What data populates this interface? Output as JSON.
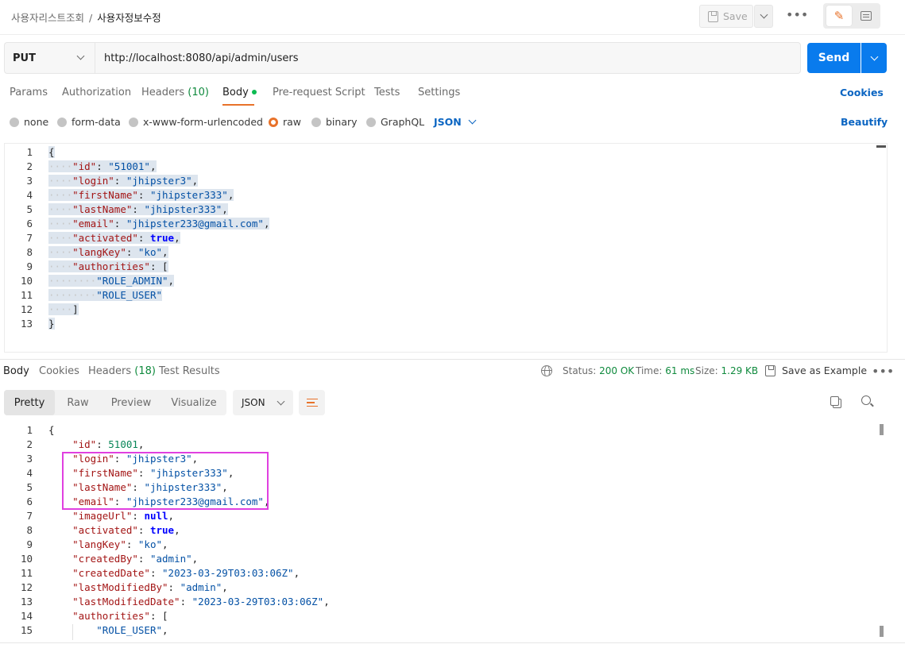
{
  "breadcrumb": {
    "parent": "사용자리스트조회",
    "separator": "/",
    "current": "사용자정보수정"
  },
  "header": {
    "save_label": "Save",
    "more_icon": "more-horizontal-icon"
  },
  "request": {
    "method": "PUT",
    "url": "http://localhost:8080/api/admin/users",
    "send_label": "Send"
  },
  "request_tabs": {
    "params": "Params",
    "authorization": "Authorization",
    "headers": "Headers",
    "headers_count": "(10)",
    "body": "Body",
    "prerequest": "Pre-request Script",
    "tests": "Tests",
    "settings": "Settings",
    "cookies": "Cookies"
  },
  "body_types": {
    "none": "none",
    "form_data": "form-data",
    "urlencoded": "x-www-form-urlencoded",
    "raw": "raw",
    "binary": "binary",
    "graphql": "GraphQL",
    "format": "JSON",
    "beautify": "Beautify"
  },
  "request_body": [
    {
      "ln": "1",
      "indent": 0,
      "parts": [
        {
          "t": "{",
          "c": "p"
        }
      ]
    },
    {
      "ln": "2",
      "indent": 1,
      "parts": [
        {
          "t": "\"id\"",
          "c": "k"
        },
        {
          "t": ": ",
          "c": "p"
        },
        {
          "t": "\"51001\"",
          "c": "s"
        },
        {
          "t": ",",
          "c": "p"
        }
      ]
    },
    {
      "ln": "3",
      "indent": 1,
      "parts": [
        {
          "t": "\"login\"",
          "c": "k"
        },
        {
          "t": ": ",
          "c": "p"
        },
        {
          "t": "\"jhipster3\"",
          "c": "s"
        },
        {
          "t": ",",
          "c": "p"
        }
      ]
    },
    {
      "ln": "4",
      "indent": 1,
      "parts": [
        {
          "t": "\"firstName\"",
          "c": "k"
        },
        {
          "t": ": ",
          "c": "p"
        },
        {
          "t": "\"jhipster333\"",
          "c": "s"
        },
        {
          "t": ",",
          "c": "p"
        }
      ]
    },
    {
      "ln": "5",
      "indent": 1,
      "parts": [
        {
          "t": "\"lastName\"",
          "c": "k"
        },
        {
          "t": ": ",
          "c": "p"
        },
        {
          "t": "\"jhipster333\"",
          "c": "s"
        },
        {
          "t": ",",
          "c": "p"
        }
      ]
    },
    {
      "ln": "6",
      "indent": 1,
      "parts": [
        {
          "t": "\"email\"",
          "c": "k"
        },
        {
          "t": ": ",
          "c": "p"
        },
        {
          "t": "\"jhipster233@gmail.com\"",
          "c": "s"
        },
        {
          "t": ",",
          "c": "p"
        }
      ]
    },
    {
      "ln": "7",
      "indent": 1,
      "parts": [
        {
          "t": "\"activated\"",
          "c": "k"
        },
        {
          "t": ": ",
          "c": "p"
        },
        {
          "t": "true",
          "c": "b"
        },
        {
          "t": ",",
          "c": "p"
        }
      ]
    },
    {
      "ln": "8",
      "indent": 1,
      "parts": [
        {
          "t": "\"langKey\"",
          "c": "k"
        },
        {
          "t": ": ",
          "c": "p"
        },
        {
          "t": "\"ko\"",
          "c": "s"
        },
        {
          "t": ",",
          "c": "p"
        }
      ]
    },
    {
      "ln": "9",
      "indent": 1,
      "parts": [
        {
          "t": "\"authorities\"",
          "c": "k"
        },
        {
          "t": ": [",
          "c": "p"
        }
      ]
    },
    {
      "ln": "10",
      "indent": 2,
      "parts": [
        {
          "t": "\"ROLE_ADMIN\"",
          "c": "s"
        },
        {
          "t": ",",
          "c": "p"
        }
      ]
    },
    {
      "ln": "11",
      "indent": 2,
      "parts": [
        {
          "t": "\"ROLE_USER\"",
          "c": "s"
        }
      ]
    },
    {
      "ln": "12",
      "indent": 1,
      "parts": [
        {
          "t": "]",
          "c": "p"
        }
      ]
    },
    {
      "ln": "13",
      "indent": 0,
      "parts": [
        {
          "t": "}",
          "c": "p"
        }
      ]
    }
  ],
  "response_tabs": {
    "body": "Body",
    "cookies": "Cookies",
    "headers": "Headers",
    "headers_count": "(18)",
    "test_results": "Test Results"
  },
  "response_meta": {
    "status_label": "Status:",
    "status_value": "200 OK",
    "time_label": "Time:",
    "time_value": "61 ms",
    "size_label": "Size:",
    "size_value": "1.29 KB",
    "save_example": "Save as Example"
  },
  "response_views": {
    "pretty": "Pretty",
    "raw": "Raw",
    "preview": "Preview",
    "visualize": "Visualize",
    "format": "JSON"
  },
  "response_body": [
    {
      "ln": "1",
      "indent": 0,
      "parts": [
        {
          "t": "{",
          "c": "p"
        }
      ]
    },
    {
      "ln": "2",
      "indent": 1,
      "parts": [
        {
          "t": "\"id\"",
          "c": "k"
        },
        {
          "t": ": ",
          "c": "p"
        },
        {
          "t": "51001",
          "c": "n"
        },
        {
          "t": ",",
          "c": "p"
        }
      ]
    },
    {
      "ln": "3",
      "indent": 1,
      "parts": [
        {
          "t": "\"login\"",
          "c": "k"
        },
        {
          "t": ": ",
          "c": "p"
        },
        {
          "t": "\"jhipster3\"",
          "c": "s"
        },
        {
          "t": ",",
          "c": "p"
        }
      ]
    },
    {
      "ln": "4",
      "indent": 1,
      "parts": [
        {
          "t": "\"firstName\"",
          "c": "k"
        },
        {
          "t": ": ",
          "c": "p"
        },
        {
          "t": "\"jhipster333\"",
          "c": "s"
        },
        {
          "t": ",",
          "c": "p"
        }
      ]
    },
    {
      "ln": "5",
      "indent": 1,
      "parts": [
        {
          "t": "\"lastName\"",
          "c": "k"
        },
        {
          "t": ": ",
          "c": "p"
        },
        {
          "t": "\"jhipster333\"",
          "c": "s"
        },
        {
          "t": ",",
          "c": "p"
        }
      ]
    },
    {
      "ln": "6",
      "indent": 1,
      "parts": [
        {
          "t": "\"email\"",
          "c": "k"
        },
        {
          "t": ": ",
          "c": "p"
        },
        {
          "t": "\"jhipster233@gmail.com\"",
          "c": "s"
        },
        {
          "t": ",",
          "c": "p"
        }
      ]
    },
    {
      "ln": "7",
      "indent": 1,
      "parts": [
        {
          "t": "\"imageUrl\"",
          "c": "k"
        },
        {
          "t": ": ",
          "c": "p"
        },
        {
          "t": "null",
          "c": "b"
        },
        {
          "t": ",",
          "c": "p"
        }
      ]
    },
    {
      "ln": "8",
      "indent": 1,
      "parts": [
        {
          "t": "\"activated\"",
          "c": "k"
        },
        {
          "t": ": ",
          "c": "p"
        },
        {
          "t": "true",
          "c": "b"
        },
        {
          "t": ",",
          "c": "p"
        }
      ]
    },
    {
      "ln": "9",
      "indent": 1,
      "parts": [
        {
          "t": "\"langKey\"",
          "c": "k"
        },
        {
          "t": ": ",
          "c": "p"
        },
        {
          "t": "\"ko\"",
          "c": "s"
        },
        {
          "t": ",",
          "c": "p"
        }
      ]
    },
    {
      "ln": "10",
      "indent": 1,
      "parts": [
        {
          "t": "\"createdBy\"",
          "c": "k"
        },
        {
          "t": ": ",
          "c": "p"
        },
        {
          "t": "\"admin\"",
          "c": "s"
        },
        {
          "t": ",",
          "c": "p"
        }
      ]
    },
    {
      "ln": "11",
      "indent": 1,
      "parts": [
        {
          "t": "\"createdDate\"",
          "c": "k"
        },
        {
          "t": ": ",
          "c": "p"
        },
        {
          "t": "\"2023-03-29T03:03:06Z\"",
          "c": "s"
        },
        {
          "t": ",",
          "c": "p"
        }
      ]
    },
    {
      "ln": "12",
      "indent": 1,
      "parts": [
        {
          "t": "\"lastModifiedBy\"",
          "c": "k"
        },
        {
          "t": ": ",
          "c": "p"
        },
        {
          "t": "\"admin\"",
          "c": "s"
        },
        {
          "t": ",",
          "c": "p"
        }
      ]
    },
    {
      "ln": "13",
      "indent": 1,
      "parts": [
        {
          "t": "\"lastModifiedDate\"",
          "c": "k"
        },
        {
          "t": ": ",
          "c": "p"
        },
        {
          "t": "\"2023-03-29T03:03:06Z\"",
          "c": "s"
        },
        {
          "t": ",",
          "c": "p"
        }
      ]
    },
    {
      "ln": "14",
      "indent": 1,
      "parts": [
        {
          "t": "\"authorities\"",
          "c": "k"
        },
        {
          "t": ": [",
          "c": "p"
        }
      ]
    },
    {
      "ln": "15",
      "indent": 2,
      "parts": [
        {
          "t": "\"ROLE_USER\"",
          "c": "s"
        },
        {
          "t": ",",
          "c": "p"
        }
      ]
    }
  ],
  "colors": {
    "accent": "#e8722a",
    "send": "#097bed",
    "link": "#0b65c2",
    "status_ok": "#0f8a3d",
    "highlight_box": "#e040e0"
  }
}
